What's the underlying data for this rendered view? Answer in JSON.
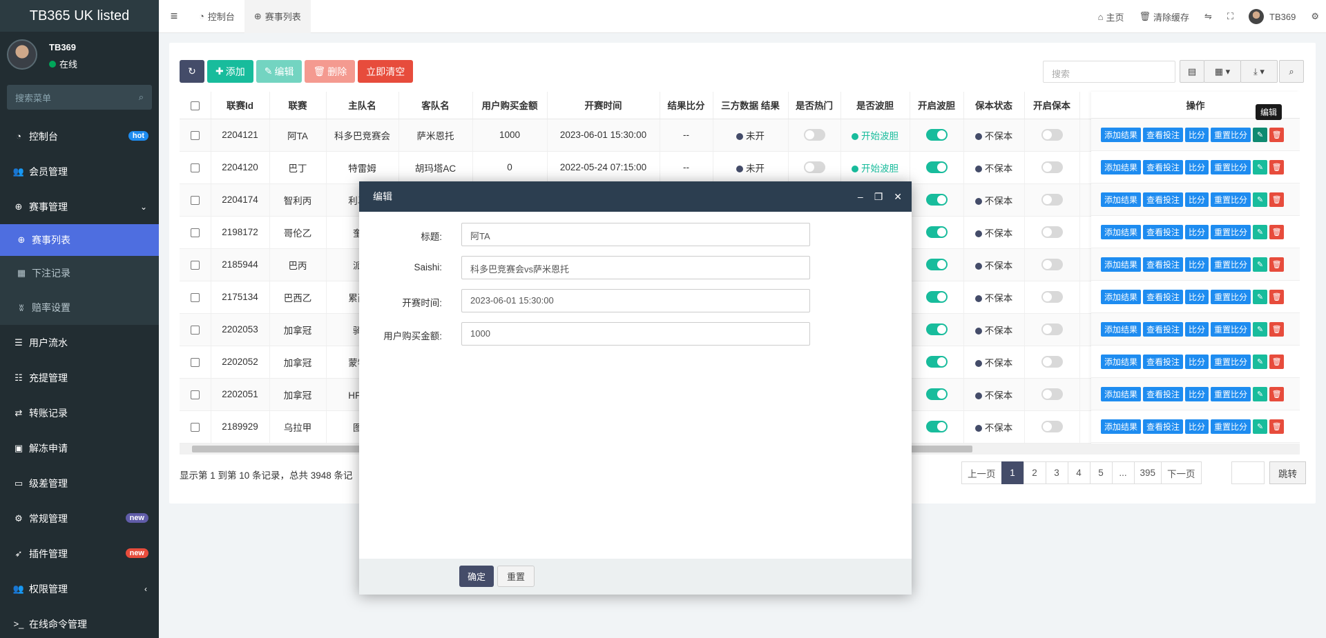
{
  "app": {
    "title": "TB365 UK listed"
  },
  "user": {
    "name": "TB369",
    "status": "在线"
  },
  "sidebar": {
    "search_placeholder": "搜索菜单",
    "items": [
      {
        "label": "控制台",
        "badge": "hot",
        "badge_color": "#1e8cf0"
      },
      {
        "label": "会员管理"
      },
      {
        "label": "赛事管理"
      },
      {
        "label": "赛事列表"
      },
      {
        "label": "下注记录"
      },
      {
        "label": "赔率设置"
      },
      {
        "label": "用户流水"
      },
      {
        "label": "充提管理"
      },
      {
        "label": "转账记录"
      },
      {
        "label": "解冻申请"
      },
      {
        "label": "级差管理"
      },
      {
        "label": "常规管理",
        "badge": "new",
        "badge_color": "#605ca8"
      },
      {
        "label": "插件管理",
        "badge": "new",
        "badge_color": "#e74c3c"
      },
      {
        "label": "权限管理"
      },
      {
        "label": "在线命令管理"
      }
    ]
  },
  "header": {
    "tabs": [
      "控制台",
      "赛事列表"
    ],
    "links": {
      "home": "主页",
      "clear_cache": "清除缓存",
      "username": "TB369"
    }
  },
  "toolbar": {
    "add": "添加",
    "edit": "编辑",
    "delete": "删除",
    "clear_now": "立即清空",
    "search_placeholder": "搜索"
  },
  "table": {
    "headers": [
      "联赛Id",
      "联赛",
      "主队名",
      "客队名",
      "用户购买金额",
      "开赛时间",
      "结果比分",
      "三方数据 结果",
      "是否热门",
      "是否波胆",
      "开启波胆",
      "保本状态",
      "开启保本",
      "操作"
    ],
    "rows": [
      {
        "id": "2204121",
        "league": "阿TA",
        "home": "科多巴竞赛会",
        "away": "萨米恩托",
        "amount": "1000",
        "time": "2023-06-01 15:30:00",
        "score": "--",
        "third": "未开",
        "bodan": "开始波胆",
        "baoben": "不保本"
      },
      {
        "id": "2204120",
        "league": "巴丁",
        "home": "特雷姆",
        "away": "胡玛塔AC",
        "amount": "0",
        "time": "2022-05-24 07:15:00",
        "score": "--",
        "third": "未开",
        "bodan": "开始波胆",
        "baoben": "不保本"
      },
      {
        "id": "2204174",
        "league": "智利丙",
        "home": "利马城",
        "baoben": "不保本"
      },
      {
        "id": "2198172",
        "league": "哥伦乙",
        "home": "奎迪",
        "baoben": "不保本"
      },
      {
        "id": "2185944",
        "league": "巴丙",
        "home": "派瑞",
        "baoben": "不保本"
      },
      {
        "id": "2175134",
        "league": "巴西乙",
        "home": "累西腓",
        "baoben": "不保本"
      },
      {
        "id": "2202053",
        "league": "加拿冠",
        "home": "骑兵",
        "baoben": "不保本"
      },
      {
        "id": "2202052",
        "league": "加拿冠",
        "home": "蒙特利",
        "baoben": "不保本"
      },
      {
        "id": "2202051",
        "league": "加拿冠",
        "home": "HFX流",
        "baoben": "不保本"
      },
      {
        "id": "2189929",
        "league": "乌拉甲",
        "home": "图尔",
        "baoben": "不保本"
      }
    ],
    "ops": {
      "add_result": "添加结果",
      "view_bets": "查看投注",
      "score": "比分",
      "reset_score": "重置比分"
    },
    "tooltip": "编辑"
  },
  "footer": {
    "info": "显示第 1 到第 10 条记录，总共 3948 条记",
    "prev": "上一页",
    "pages": [
      "1",
      "2",
      "3",
      "4",
      "5",
      "...",
      "395"
    ],
    "next": "下一页",
    "jump": "跳转"
  },
  "modal": {
    "title": "编辑",
    "fields": [
      {
        "label": "标题:",
        "value": "阿TA"
      },
      {
        "label": "Saishi:",
        "value": "科多巴竞赛会vs萨米恩托"
      },
      {
        "label": "开赛时间:",
        "value": "2023-06-01 15:30:00"
      },
      {
        "label": "用户购买金额:",
        "value": "1000"
      }
    ],
    "ok": "确定",
    "reset": "重置"
  }
}
